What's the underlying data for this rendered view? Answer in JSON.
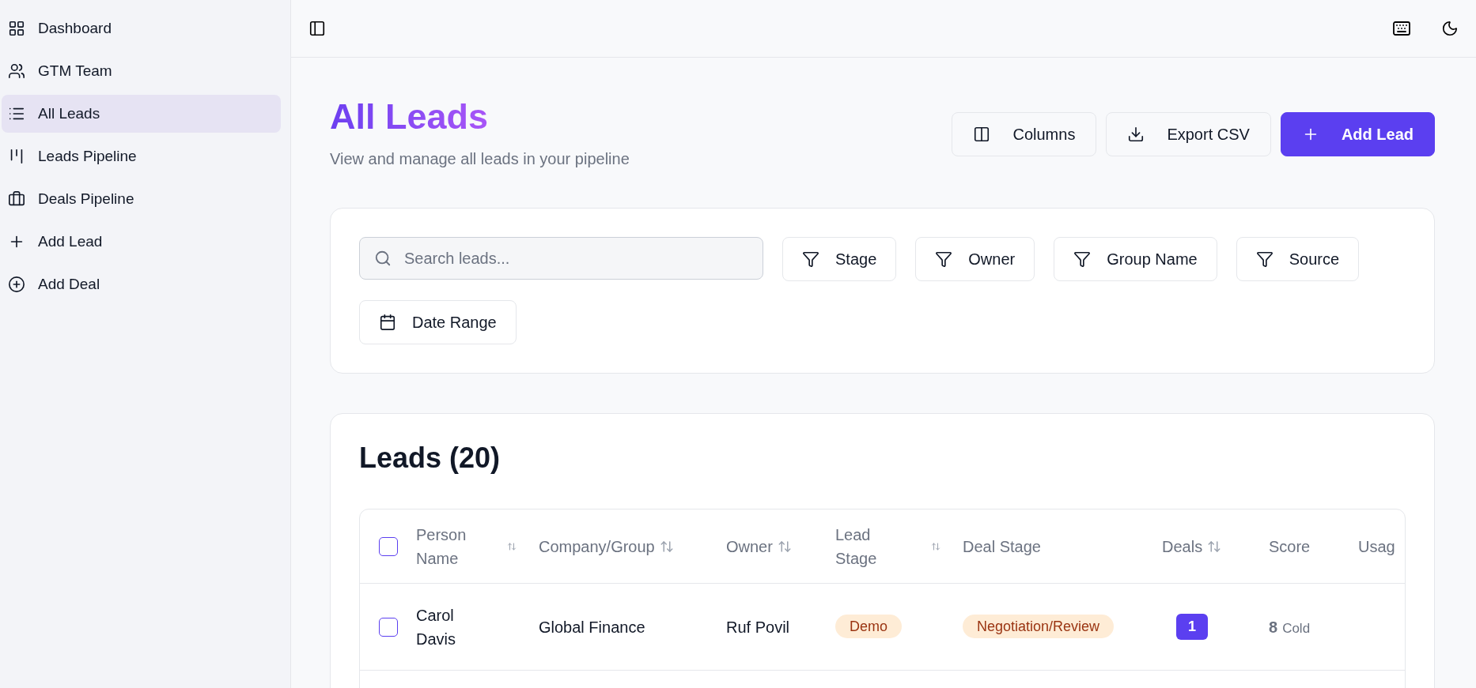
{
  "sidebar": {
    "items": [
      {
        "label": "Dashboard",
        "selected": false
      },
      {
        "label": "GTM Team",
        "selected": false
      },
      {
        "label": "All Leads",
        "selected": true
      },
      {
        "label": "Leads Pipeline",
        "selected": false
      },
      {
        "label": "Deals Pipeline",
        "selected": false
      },
      {
        "label": "Add Lead",
        "selected": false
      },
      {
        "label": "Add Deal",
        "selected": false
      }
    ]
  },
  "page": {
    "title": "All Leads",
    "subtitle": "View and manage all leads in your pipeline",
    "actions": [
      {
        "label": "Columns",
        "kind": "columns"
      },
      {
        "label": "Export CSV",
        "kind": "export"
      },
      {
        "label": "Add Lead",
        "kind": "primary"
      }
    ]
  },
  "filters": {
    "search": {
      "placeholder": "Search leads..."
    },
    "buttons": [
      {
        "label": "Stage",
        "kind": "filter"
      },
      {
        "label": "Owner",
        "kind": "filter"
      },
      {
        "label": "Group Name",
        "kind": "filter"
      },
      {
        "label": "Source",
        "kind": "filter"
      },
      {
        "label": "Date Range",
        "kind": "date"
      }
    ]
  },
  "table": {
    "title": "Leads (20)",
    "columns": [
      {
        "label": "Person Name",
        "sortable": true
      },
      {
        "label": "Company/Group",
        "sortable": true
      },
      {
        "label": "Owner",
        "sortable": true
      },
      {
        "label": "Lead Stage",
        "sortable": true
      },
      {
        "label": "Deal Stage",
        "sortable": false
      },
      {
        "label": "Deals",
        "sortable": true
      },
      {
        "label": "Score",
        "sortable": false
      },
      {
        "label": "Usag",
        "sortable": false
      }
    ],
    "rows": [
      {
        "checked": false,
        "person": "Carol Davis",
        "company": "Global Finance",
        "owner": "Ruf Povil",
        "lead_stage": "Demo",
        "deal_stage": "Negotiation/Review",
        "deals": "1",
        "score": "8",
        "score_label": "Cold"
      }
    ],
    "select_all": {
      "checked": false
    }
  }
}
